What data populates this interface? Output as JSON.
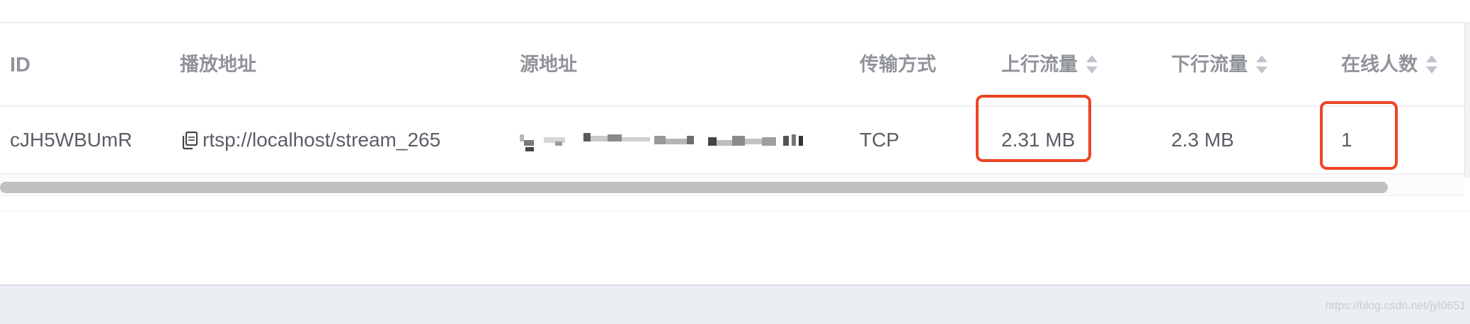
{
  "table": {
    "headers": {
      "id": "ID",
      "play_url": "播放地址",
      "source_url": "源地址",
      "transport": "传输方式",
      "upstream": "上行流量",
      "downstream": "下行流量",
      "online": "在线人数"
    },
    "rows": [
      {
        "id": "cJH5WBUmR",
        "play_url": "rtsp://localhost/stream_265",
        "source_url": "",
        "transport": "TCP",
        "upstream": "2.31 MB",
        "downstream": "2.3 MB",
        "online": "1"
      }
    ]
  },
  "icons": {
    "copy": "copy-icon",
    "sort": "sort-caret-icon"
  },
  "colors": {
    "highlight": "#ee4423",
    "header_text": "#909399",
    "body_text": "#5a5e66",
    "scrollbar": "#c1c1c1"
  },
  "watermark": "https://blog.csdn.net/jyl0651"
}
